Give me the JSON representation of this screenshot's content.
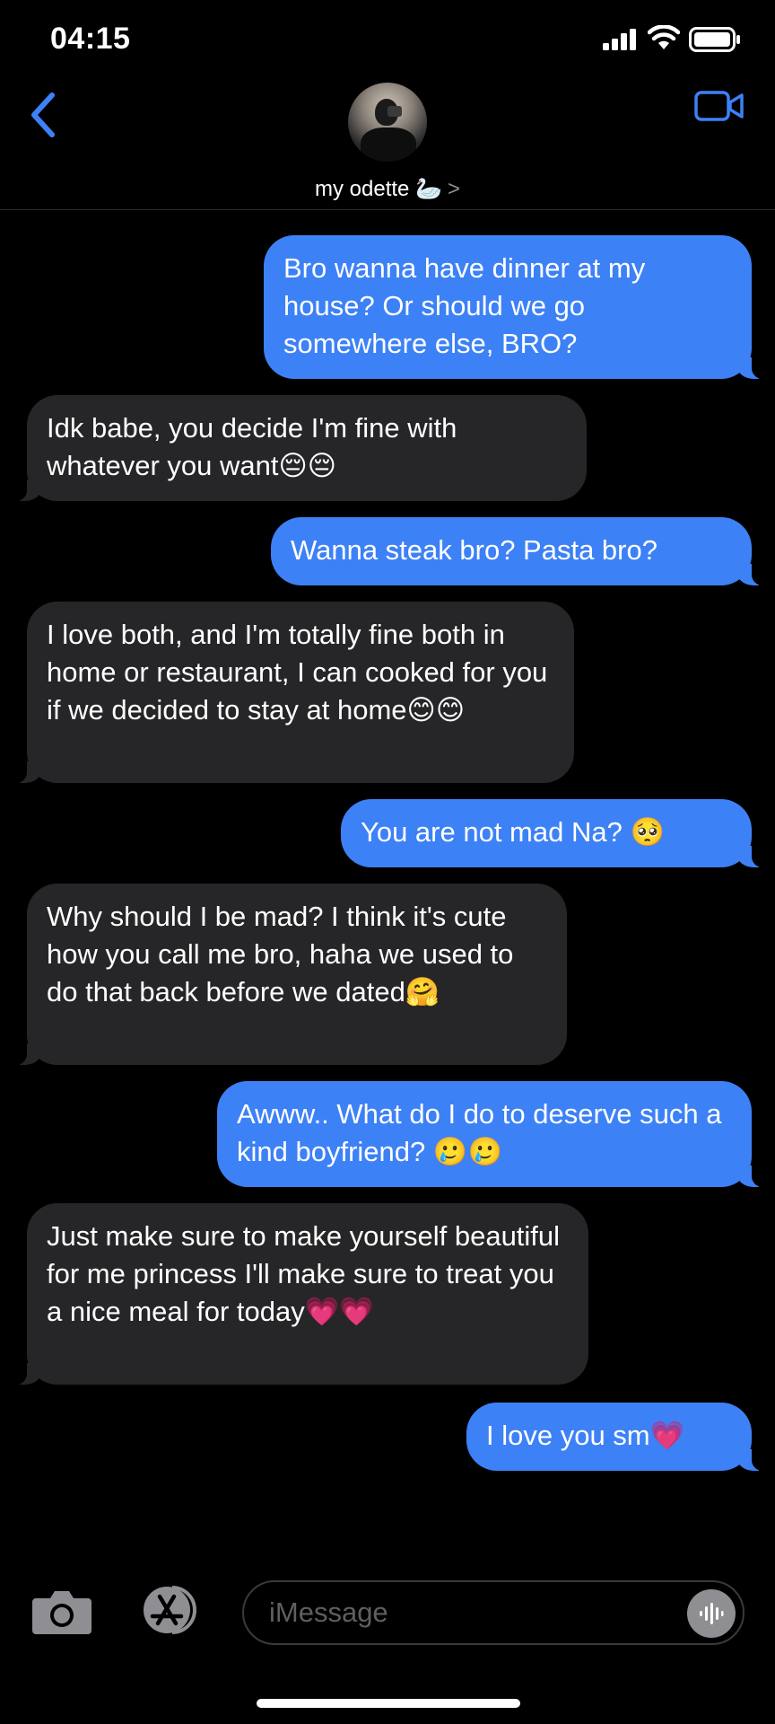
{
  "status_bar": {
    "time": "04:15"
  },
  "header": {
    "contact_name": "my odette 🦢",
    "contact_chevron": ">"
  },
  "messages": [
    {
      "side": "sent",
      "text": "Bro wanna have dinner at my house? Or should we go somewhere else, BRO?"
    },
    {
      "side": "received",
      "text": "Idk babe, you decide I'm fine with whatever you want😔😔"
    },
    {
      "side": "sent",
      "text": "Wanna steak bro? Pasta bro?"
    },
    {
      "side": "received",
      "text": "I love both, and I'm totally fine both in home or restaurant, I can cooked for you if we decided to stay at home😊😊"
    },
    {
      "side": "sent",
      "text": "You are not mad Na? 🥺"
    },
    {
      "side": "received",
      "text": "Why should I be mad? I think it's cute how you call me bro, haha we used to do that back before we dated🤗"
    },
    {
      "side": "sent",
      "text": "Awww.. What do I do to deserve such a kind boyfriend? 🥲🥲"
    },
    {
      "side": "received",
      "text": "Just make sure to make yourself beautiful for me princess I'll make sure to treat you a nice meal for today💗💗"
    },
    {
      "side": "sent",
      "text": "I love you sm💗"
    }
  ],
  "composer": {
    "placeholder": "iMessage"
  },
  "colors": {
    "sent_bubble": "#3d81f6",
    "received_bubble": "#262628",
    "accent": "#3d81f6",
    "background": "#000000"
  },
  "icons": [
    "back-chevron-icon",
    "facetime-video-icon",
    "camera-icon",
    "app-store-icon",
    "audio-message-icon"
  ]
}
